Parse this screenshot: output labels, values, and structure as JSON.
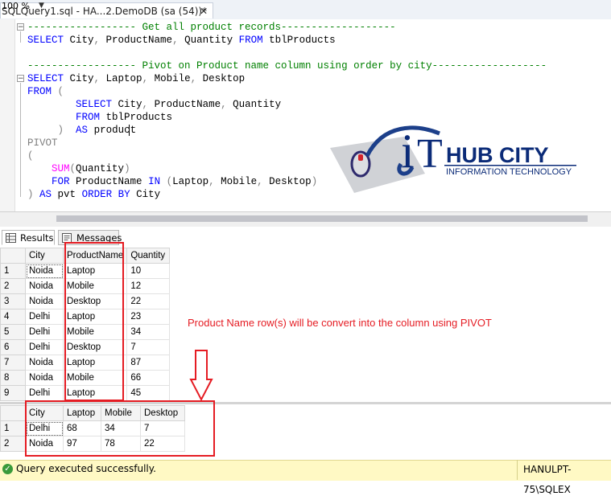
{
  "window": {
    "tab_title": "SQLQuery1.sql - HA...2.DemoDB (sa (54))*",
    "close_glyph": "✕"
  },
  "editor": {
    "lines": [
      {
        "segments": [
          {
            "t": "------------------ Get all product records-------------------",
            "c": "cm"
          }
        ]
      },
      {
        "segments": [
          {
            "t": "SELECT",
            "c": "kw"
          },
          {
            "t": " City",
            "c": "tx"
          },
          {
            "t": ",",
            "c": "gr"
          },
          {
            "t": " ProductName",
            "c": "tx"
          },
          {
            "t": ",",
            "c": "gr"
          },
          {
            "t": " Quantity ",
            "c": "tx"
          },
          {
            "t": "FROM",
            "c": "kw"
          },
          {
            "t": " tblProducts",
            "c": "tx"
          }
        ]
      },
      {
        "segments": []
      },
      {
        "segments": [
          {
            "t": "------------------ Pivot on Product name column using order by city-------------------",
            "c": "cm"
          }
        ]
      },
      {
        "segments": [
          {
            "t": "SELECT",
            "c": "kw"
          },
          {
            "t": " City",
            "c": "tx"
          },
          {
            "t": ",",
            "c": "gr"
          },
          {
            "t": " Laptop",
            "c": "tx"
          },
          {
            "t": ",",
            "c": "gr"
          },
          {
            "t": " Mobile",
            "c": "tx"
          },
          {
            "t": ",",
            "c": "gr"
          },
          {
            "t": " Desktop",
            "c": "tx"
          }
        ]
      },
      {
        "segments": [
          {
            "t": "FROM",
            "c": "kw"
          },
          {
            "t": " (",
            "c": "gr"
          }
        ]
      },
      {
        "segments": [
          {
            "t": "        ",
            "c": "tx"
          },
          {
            "t": "SELECT",
            "c": "kw"
          },
          {
            "t": " City",
            "c": "tx"
          },
          {
            "t": ",",
            "c": "gr"
          },
          {
            "t": " ProductName",
            "c": "tx"
          },
          {
            "t": ",",
            "c": "gr"
          },
          {
            "t": " Quantity",
            "c": "tx"
          }
        ]
      },
      {
        "segments": [
          {
            "t": "        ",
            "c": "tx"
          },
          {
            "t": "FROM",
            "c": "kw"
          },
          {
            "t": " tblProducts",
            "c": "tx"
          }
        ]
      },
      {
        "segments": [
          {
            "t": "     ",
            "c": "tx"
          },
          {
            "t": ")",
            "c": "gr"
          },
          {
            "t": "  ",
            "c": "tx"
          },
          {
            "t": "AS",
            "c": "kw"
          },
          {
            "t": " product",
            "c": "tx"
          }
        ]
      },
      {
        "segments": [
          {
            "t": "PIVOT",
            "c": "gr"
          }
        ]
      },
      {
        "segments": [
          {
            "t": "(",
            "c": "gr"
          }
        ]
      },
      {
        "segments": [
          {
            "t": "    ",
            "c": "tx"
          },
          {
            "t": "SUM",
            "c": "fn"
          },
          {
            "t": "(",
            "c": "gr"
          },
          {
            "t": "Quantity",
            "c": "tx"
          },
          {
            "t": ")",
            "c": "gr"
          }
        ]
      },
      {
        "segments": [
          {
            "t": "    ",
            "c": "tx"
          },
          {
            "t": "FOR",
            "c": "kw"
          },
          {
            "t": " ProductName ",
            "c": "tx"
          },
          {
            "t": "IN",
            "c": "kw"
          },
          {
            "t": " ",
            "c": "tx"
          },
          {
            "t": "(",
            "c": "gr"
          },
          {
            "t": "Laptop",
            "c": "tx"
          },
          {
            "t": ",",
            "c": "gr"
          },
          {
            "t": " Mobile",
            "c": "tx"
          },
          {
            "t": ",",
            "c": "gr"
          },
          {
            "t": " Desktop",
            "c": "tx"
          },
          {
            "t": ")",
            "c": "gr"
          }
        ]
      },
      {
        "segments": [
          {
            "t": ")",
            "c": "gr"
          },
          {
            "t": " ",
            "c": "tx"
          },
          {
            "t": "AS",
            "c": "kw"
          },
          {
            "t": " pvt ",
            "c": "tx"
          },
          {
            "t": "ORDER",
            "c": "kw"
          },
          {
            "t": " ",
            "c": "tx"
          },
          {
            "t": "BY",
            "c": "kw"
          },
          {
            "t": " City",
            "c": "tx"
          }
        ]
      }
    ]
  },
  "logo": {
    "letter_i": "i",
    "letter_t": "T",
    "main": "HUB CITY",
    "sub": "INFORMATION TECHNOLOGY"
  },
  "zoom": {
    "value": "100 %",
    "arrow": "▼"
  },
  "result_tabs": {
    "results_label": "Results",
    "messages_label": "Messages"
  },
  "grid1": {
    "columns": [
      "City",
      "ProductName",
      "Quantity"
    ],
    "rows": [
      {
        "n": "1",
        "cells": [
          "Noida",
          "Laptop",
          "10"
        ]
      },
      {
        "n": "2",
        "cells": [
          "Noida",
          "Mobile",
          "12"
        ]
      },
      {
        "n": "3",
        "cells": [
          "Noida",
          "Desktop",
          "22"
        ]
      },
      {
        "n": "4",
        "cells": [
          "Delhi",
          "Laptop",
          "23"
        ]
      },
      {
        "n": "5",
        "cells": [
          "Delhi",
          "Mobile",
          "34"
        ]
      },
      {
        "n": "6",
        "cells": [
          "Delhi",
          "Desktop",
          "7"
        ]
      },
      {
        "n": "7",
        "cells": [
          "Noida",
          "Laptop",
          "87"
        ]
      },
      {
        "n": "8",
        "cells": [
          "Noida",
          "Mobile",
          "66"
        ]
      },
      {
        "n": "9",
        "cells": [
          "Delhi",
          "Laptop",
          "45"
        ]
      }
    ]
  },
  "grid2": {
    "columns": [
      "City",
      "Laptop",
      "Mobile",
      "Desktop"
    ],
    "rows": [
      {
        "n": "1",
        "cells": [
          "Delhi",
          "68",
          "34",
          "7"
        ]
      },
      {
        "n": "2",
        "cells": [
          "Noida",
          "97",
          "78",
          "22"
        ]
      }
    ]
  },
  "annotation": {
    "text": "Product Name row(s) will be convert into the column using PIVOT",
    "color": "#e51c23"
  },
  "status": {
    "message": "Query executed successfully.",
    "server": "HANULPT-75\\SQLEX",
    "icon_glyph": "✓",
    "background": "#fff9c4"
  }
}
